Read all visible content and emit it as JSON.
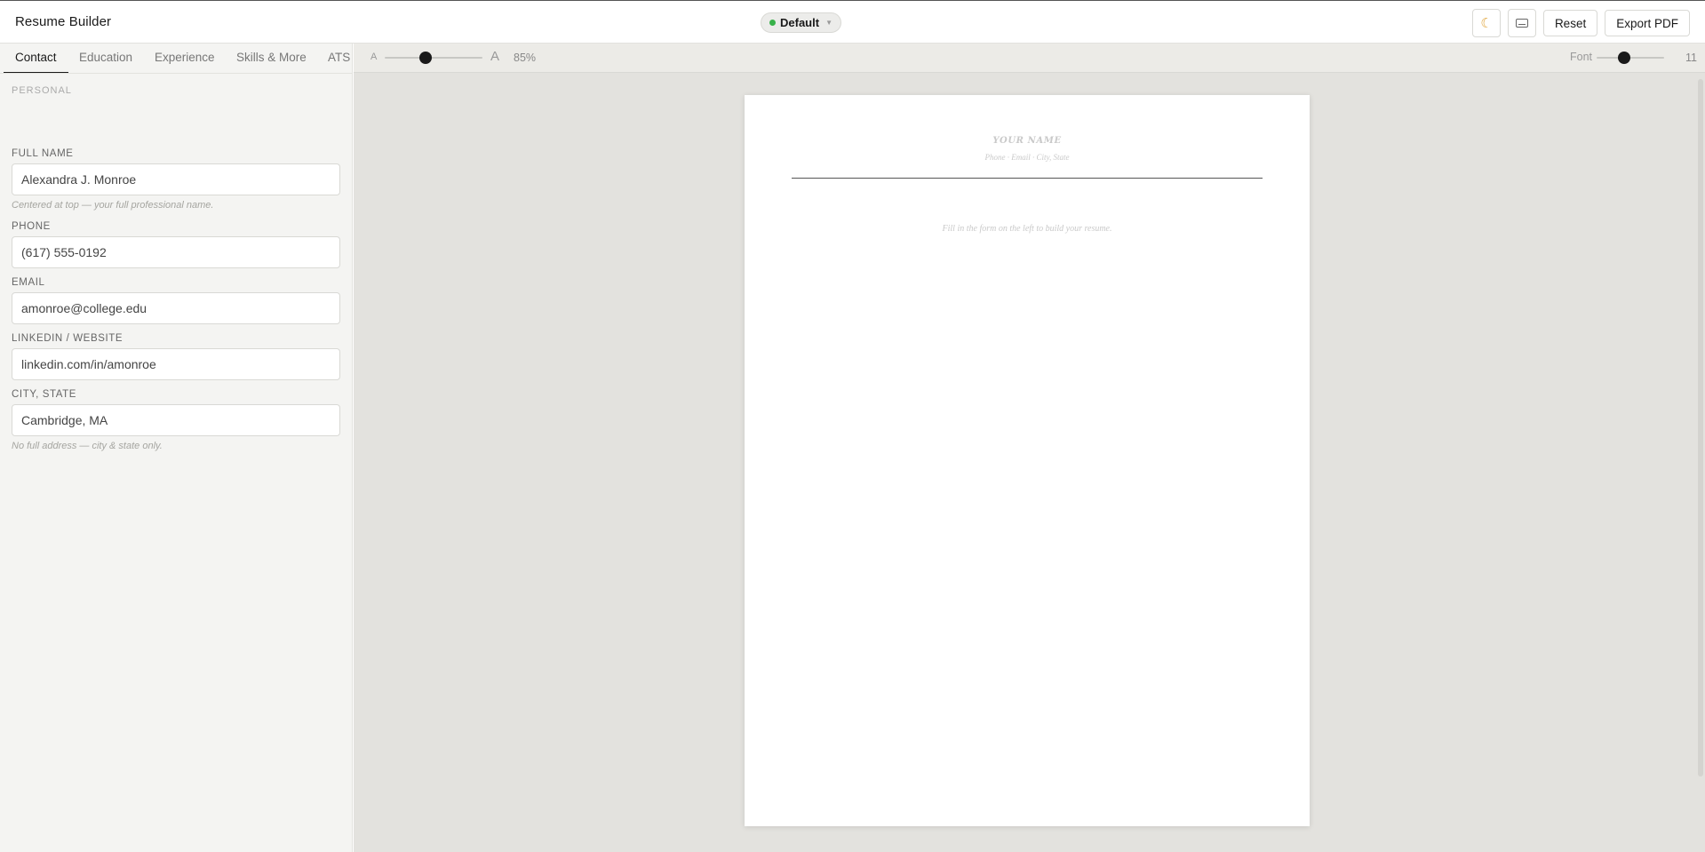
{
  "app": {
    "title": "Resume Builder"
  },
  "profile": {
    "name": "Default",
    "status_color": "#38b24a"
  },
  "top_actions": {
    "theme_icon": "moon-icon",
    "keyboard_icon": "keyboard-icon",
    "reset_label": "Reset",
    "export_label": "Export PDF"
  },
  "tabs": [
    {
      "label": "Contact",
      "active": true
    },
    {
      "label": "Education",
      "active": false
    },
    {
      "label": "Experience",
      "active": false
    },
    {
      "label": "Skills & More",
      "active": false
    },
    {
      "label": "ATS",
      "active": false
    }
  ],
  "form": {
    "section_label": "PERSONAL",
    "full_name": {
      "label": "FULL NAME",
      "value": "Alexandra J. Monroe",
      "hint": "Centered at top — your full professional name."
    },
    "phone": {
      "label": "PHONE",
      "value": "(617) 555-0192"
    },
    "email": {
      "label": "EMAIL",
      "value": "amonroe@college.edu"
    },
    "linkedin": {
      "label": "LINKEDIN / WEBSITE",
      "value": "linkedin.com/in/amonroe"
    },
    "city_state": {
      "label": "CITY, STATE",
      "value": "Cambridge, MA",
      "hint": "No full address — city & state only."
    }
  },
  "preview_toolbar": {
    "zoom_small_glyph": "A",
    "zoom_large_glyph": "A",
    "zoom_percent": "85%",
    "zoom_level": 0.85,
    "font_label": "Font",
    "font_size": "11"
  },
  "resume": {
    "name_placeholder": "YOUR NAME",
    "contact_placeholder": "Phone · Email · City, State",
    "empty_message": "Fill in the form on the left to build your resume."
  }
}
